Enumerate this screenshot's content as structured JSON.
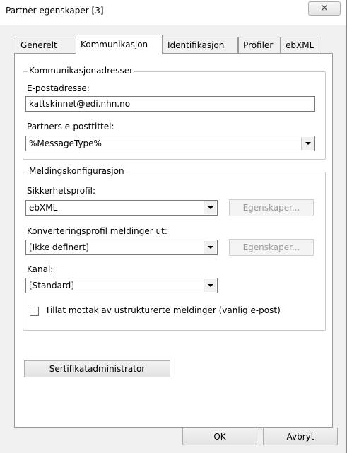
{
  "window": {
    "title": "Partner egenskaper [3]",
    "close_glyph": "✕"
  },
  "tabs": [
    {
      "label": "Generelt",
      "active": false
    },
    {
      "label": "Kommunikasjon",
      "active": true
    },
    {
      "label": "Identifikasjon",
      "active": false
    },
    {
      "label": "Profiler",
      "active": false
    },
    {
      "label": "ebXML",
      "active": false
    }
  ],
  "comm_group": {
    "legend": "Kommunikasjonadresser",
    "email_label": "E-postadresse:",
    "email_value": "kattskinnet@edi.nhn.no",
    "subject_label": "Partners e-posttittel:",
    "subject_value": "%MessageType%"
  },
  "msg_group": {
    "legend": "Meldingskonfigurasjon",
    "security_label": "Sikkerhetsprofil:",
    "security_value": "ebXML",
    "security_props": "Egenskaper...",
    "conversion_label": "Konverteringsprofil meldinger ut:",
    "conversion_value": "[Ikke definert]",
    "conversion_props": "Egenskaper...",
    "channel_label": "Kanal:",
    "channel_value": "[Standard]",
    "allow_unstructured_label": "Tillat mottak av ustrukturerte meldinger (vanlig e-post)",
    "allow_unstructured_checked": false
  },
  "cert_button": "Sertifikatadministrator",
  "footer": {
    "ok": "OK",
    "cancel": "Avbryt"
  }
}
